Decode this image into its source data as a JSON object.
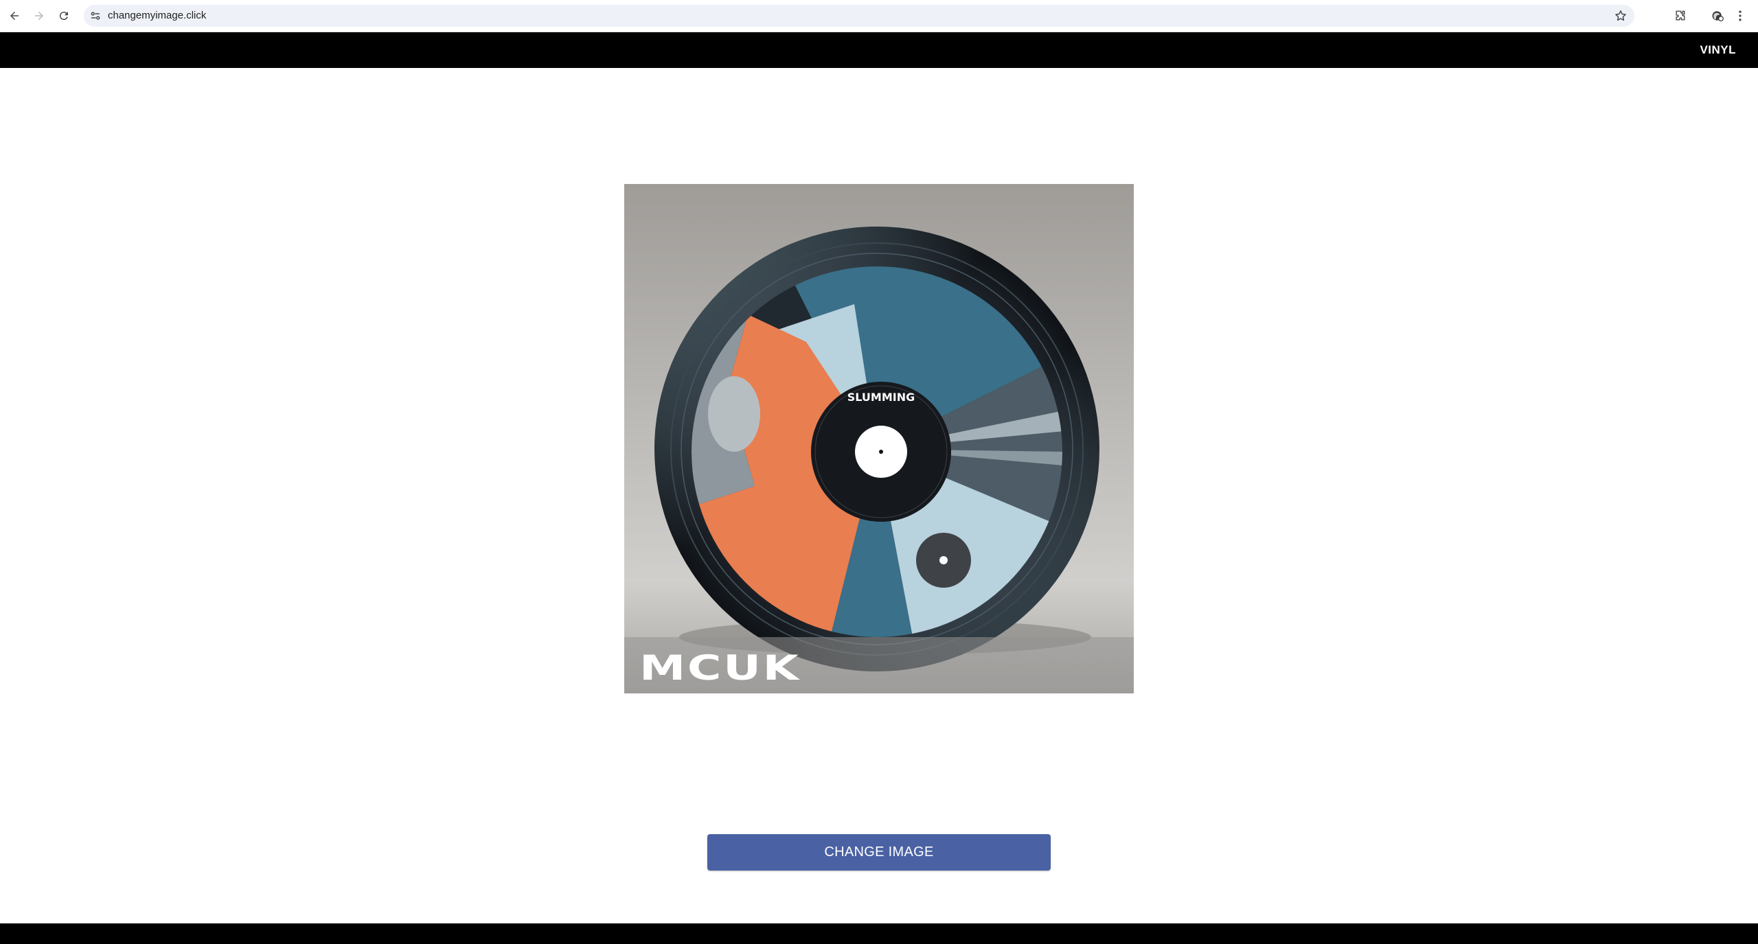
{
  "browser": {
    "url": "changemyimage.click",
    "icons": [
      "back-icon",
      "forward-icon",
      "reload-icon",
      "site-settings-icon",
      "bookmark-star-icon",
      "extensions-icon",
      "profile-icon",
      "menu-icon"
    ]
  },
  "header": {
    "brand": "VINYL"
  },
  "album": {
    "logo_text": "MCUK",
    "record_label_title": "SLUMMING",
    "colors": {
      "orange": "#e97e50",
      "teal": "#3a7089",
      "light_blue": "#b8d2de",
      "vinyl": "#1c2229"
    }
  },
  "actions": {
    "change_image_label": "CHANGE IMAGE"
  },
  "colors": {
    "header_bg": "#000000",
    "button_bg": "#4a62a4",
    "page_bg": "#ffffff"
  }
}
